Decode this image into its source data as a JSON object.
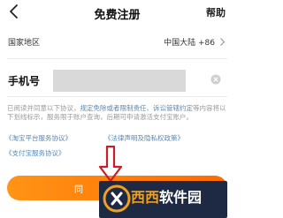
{
  "header": {
    "title": "免费注册",
    "help": "帮助"
  },
  "region": {
    "label": "国家地区",
    "value": "中国大陆 +86"
  },
  "phone": {
    "label": "手机号",
    "value": ""
  },
  "agreement": {
    "part1": "已阅读并同意以下协议，",
    "highlight": "规定免除或者限制责任、诉讼管辖约定",
    "part2": "等内容将以下划线标示，",
    "part3": "服务限于账户查询，后期可申请激活支付宝账户。"
  },
  "links": [
    "《淘宝平台服务协议》",
    "《法律声明及隐私权政策》",
    "《支付宝服务协议》"
  ],
  "button": {
    "label": "同"
  },
  "watermark": {
    "part1": "西西",
    "part2": "软件园"
  },
  "colors": {
    "accent": "#ff7a00",
    "link": "#5b88b3",
    "arrow": "#c81e2a"
  },
  "icons": {
    "back": "chevron-left-icon",
    "region": "chevron-right-icon",
    "clear": "clear-icon",
    "arrow": "down-arrow-icon"
  }
}
